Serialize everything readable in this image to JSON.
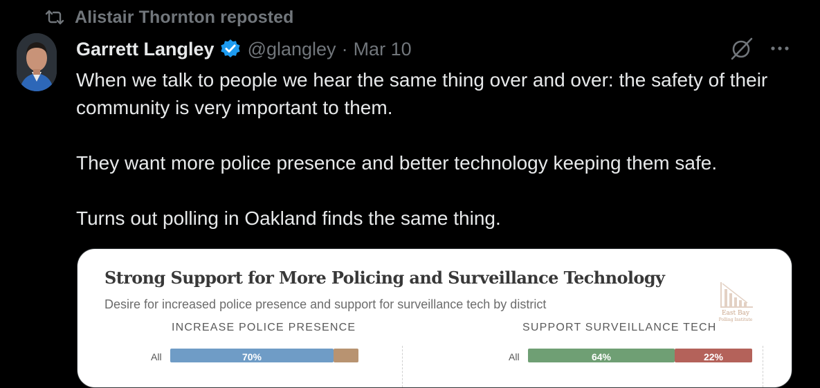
{
  "repost": {
    "text": "Alistair Thornton reposted",
    "icon": "repost-icon"
  },
  "author": {
    "name": "Garrett Langley",
    "handle": "@glangley",
    "separator": "·",
    "date": "Mar 10",
    "verified_color": "#1d9bf0",
    "avatar": "avatar"
  },
  "actions": {
    "grok_icon": "grok-icon",
    "more_icon": "more-icon"
  },
  "post": {
    "paragraphs": [
      "When we talk to people we hear the same thing over and over: the safety of their community is very important to them.",
      "They want more police presence and better technology keeping them safe.",
      "Turns out polling in Oakland finds the same thing."
    ]
  },
  "media": {
    "title": "Strong Support for More Policing and Surveillance Technology",
    "subtitle": "Desire for increased police presence and support for surveillance tech by district",
    "watermark": {
      "line1": "East Bay",
      "line2": "Polling Institute"
    },
    "left_section": {
      "label": "INCREASE POLICE PRESENCE",
      "row_label": "All",
      "segments": [
        {
          "value": "70%",
          "color": "#6f9cc6"
        },
        {
          "value": "",
          "color": "#b89371"
        }
      ]
    },
    "right_section": {
      "label": "SUPPORT SURVEILLANCE TECH",
      "row_label": "All",
      "segments": [
        {
          "value": "64%",
          "color": "#6f9f74"
        },
        {
          "value": "22%",
          "color": "#b4625a"
        }
      ]
    }
  },
  "colors": {
    "background": "#000000",
    "text": "#e7e9ea",
    "muted": "#71767b",
    "accent": "#1d9bf0"
  }
}
